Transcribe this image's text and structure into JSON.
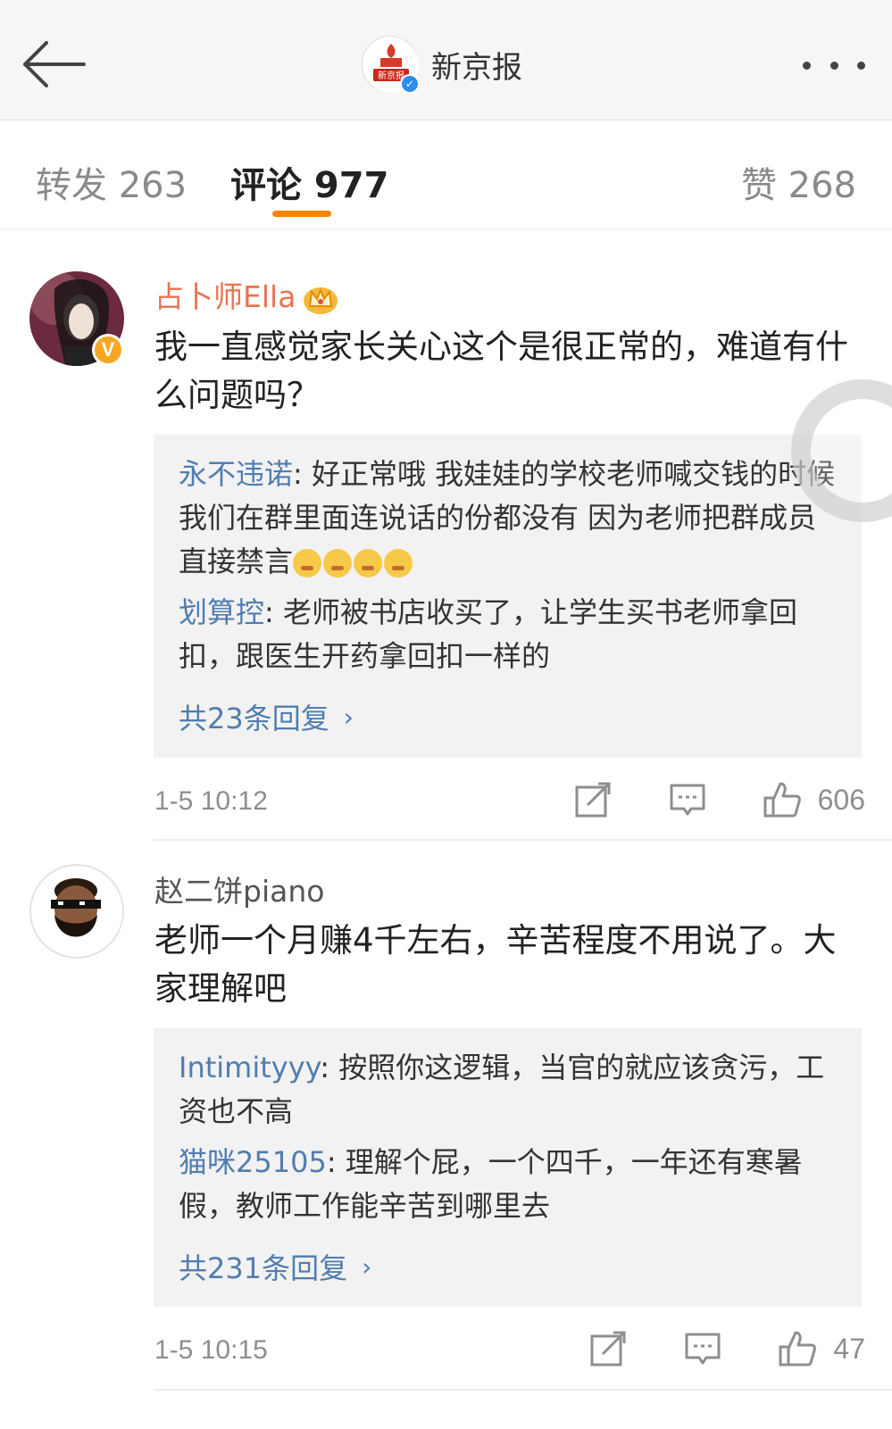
{
  "header": {
    "title": "新京报",
    "logo_text": "新京报",
    "verify_mark": "✓"
  },
  "tabs": [
    {
      "label": "转发 263"
    },
    {
      "label": "评论 977"
    },
    {
      "label": "赞 268"
    }
  ],
  "colors": {
    "accent": "#ff8200",
    "vip_name": "#eb7350",
    "reply_user": "#507daf"
  },
  "comments": [
    {
      "username": "占卜师Ella",
      "badge": "V",
      "text": "我一直感觉家长关心这个是很正常的，难道有什么问题吗？",
      "replies": [
        {
          "user": "永不违诺",
          "sep": ": ",
          "text": "好正常哦 我娃娃的学校老师喊交钱的时候 我们在群里面连说话的份都没有 因为老师把群成员直接禁言"
        },
        {
          "user": "划算控",
          "sep": ": ",
          "text": "老师被书店收买了，让学生买书老师拿回扣，跟医生开药拿回扣一样的"
        }
      ],
      "more_replies": "共23条回复",
      "time": "1-5 10:12",
      "likes": "606"
    },
    {
      "username": "赵二饼piano",
      "text": "老师一个月赚4千左右，辛苦程度不用说了。大家理解吧",
      "replies": [
        {
          "user": "Intimityyy",
          "sep": ": ",
          "text": "按照你这逻辑，当官的就应该贪污，工资也不高"
        },
        {
          "user": "猫咪25105",
          "sep": ": ",
          "text": "理解个屁，一个四千，一年还有寒暑假，教师工作能辛苦到哪里去"
        }
      ],
      "more_replies": "共231条回复",
      "time": "1-5 10:15",
      "likes": "47"
    }
  ],
  "icons": {
    "back": "arrow-left-icon",
    "more": "more-dots-icon",
    "share": "share-icon",
    "comment": "comment-icon",
    "like": "thumbs-up-icon",
    "crown": "crown-icon",
    "chevron": "›"
  }
}
